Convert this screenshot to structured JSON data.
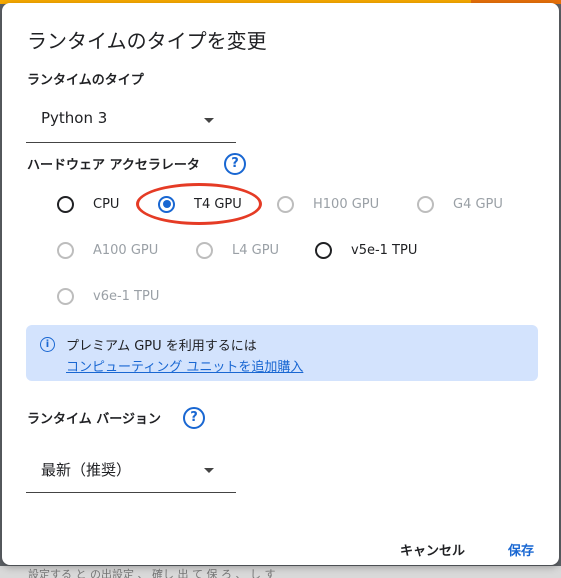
{
  "dialog": {
    "title": "ランタイムのタイプを変更",
    "runtime_type_label": "ランタイムのタイプ",
    "runtime_type_value": "Python 3",
    "hardware_label": "ハードウェア アクセラレータ",
    "help_glyph": "?",
    "accelerators": [
      {
        "label": "CPU",
        "state": "enabled"
      },
      {
        "label": "T4 GPU",
        "state": "selected"
      },
      {
        "label": "H100 GPU",
        "state": "disabled"
      },
      {
        "label": "G4 GPU",
        "state": "disabled"
      },
      {
        "label": "A100 GPU",
        "state": "disabled"
      },
      {
        "label": "L4 GPU",
        "state": "disabled"
      },
      {
        "label": "v5e-1 TPU",
        "state": "enabled"
      },
      {
        "label": "v6e-1 TPU",
        "state": "disabled"
      }
    ],
    "info_glyph": "i",
    "info_text": "プレミアム GPU を利用するには",
    "info_link": "コンピューティング ユニットを追加購入",
    "runtime_version_label": "ランタイム バージョン",
    "runtime_version_value": "最新（推奨）",
    "cancel_label": "キャンセル",
    "save_label": "保存"
  },
  "colors": {
    "accent": "#1967d2",
    "annotation_ring": "#e53b25",
    "info_bg": "#d3e3fd"
  },
  "background_text": "設定する と の出設定 、 確し 出 て 保 ろ 、 し す"
}
